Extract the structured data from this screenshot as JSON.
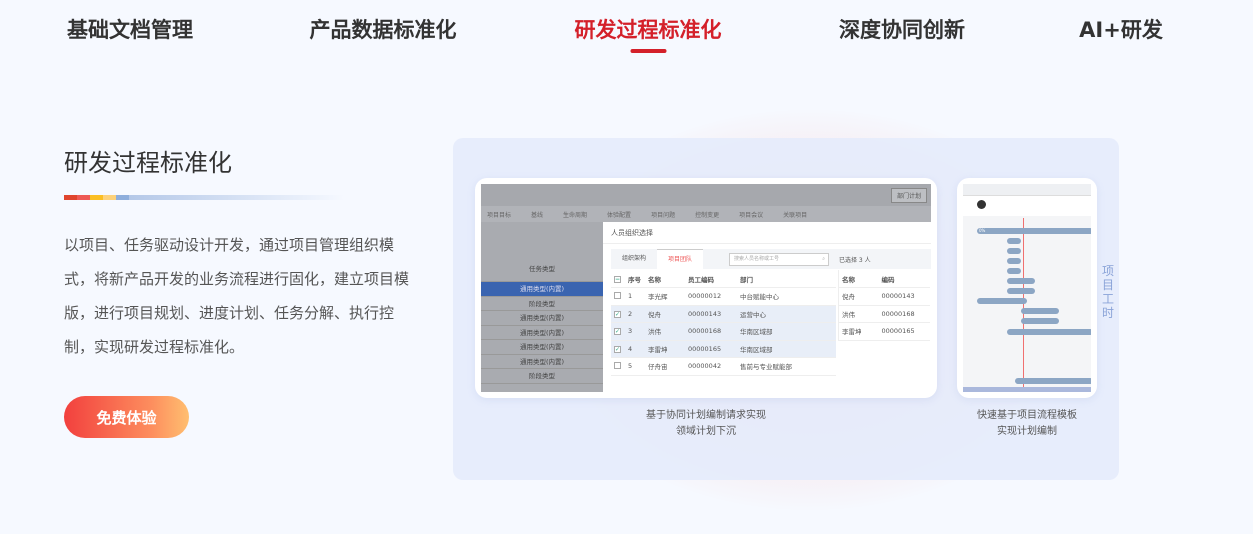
{
  "tabs": [
    {
      "label": "基础文档管理",
      "active": false
    },
    {
      "label": "产品数据标准化",
      "active": false
    },
    {
      "label": "研发过程标准化",
      "active": true
    },
    {
      "label": "深度协同创新",
      "active": false
    },
    {
      "label": "AI+研发",
      "active": false
    }
  ],
  "accent_color": "#d4202a",
  "section": {
    "title": "研发过程标准化",
    "description": "以项目、任务驱动设计开发，通过项目管理组织模式，将新产品开发的业务流程进行固化，建立项目模版，进行项目规划、进度计划、任务分解、执行控制，实现研发过程标准化。",
    "cta_label": "免费体验"
  },
  "card1": {
    "plan_button": "部门计划",
    "nav": [
      "项目目标",
      "基线",
      "生命周期",
      "体验配置",
      "项目问题",
      "控制变更",
      "项目会议",
      "关联项目"
    ],
    "left_rows": [
      "任务类型",
      "通用类型(内置)",
      "阶段类型",
      "通用类型(内置)",
      "通用类型(内置)",
      "通用类型(内置)",
      "通用类型(内置)",
      "阶段类型"
    ],
    "modal_title": "人员组织选择",
    "modal_tabs": [
      "组织架构",
      "项目团队"
    ],
    "search_placeholder": "搜索人员名称或工号",
    "selected_count": "已选择 3 人",
    "columns": [
      "序号",
      "名称",
      "员工编码",
      "部门"
    ],
    "rows": [
      {
        "no": "1",
        "name": "李光辉",
        "code": "00000012",
        "dept": "中台赋能中心",
        "checked": false
      },
      {
        "no": "2",
        "name": "倪舟",
        "code": "00000143",
        "dept": "运营中心",
        "checked": true
      },
      {
        "no": "3",
        "name": "洪伟",
        "code": "00000168",
        "dept": "华南区域部",
        "checked": true
      },
      {
        "no": "4",
        "name": "李雷坤",
        "code": "00000165",
        "dept": "华南区域部",
        "checked": true
      },
      {
        "no": "5",
        "name": "仔舟宙",
        "code": "00000042",
        "dept": "售前与专业赋能部",
        "checked": false
      }
    ],
    "selected_columns": [
      "名称",
      "编码"
    ],
    "selected": [
      {
        "name": "倪舟",
        "code": "00000143"
      },
      {
        "name": "洪伟",
        "code": "00000168"
      },
      {
        "name": "李雷坤",
        "code": "00000165"
      }
    ],
    "caption": [
      "基于协同计划编制请求实现",
      "领域计划下沉"
    ]
  },
  "card2": {
    "caption": [
      "快速基于项目流程模板",
      "实现计划编制"
    ],
    "progress_label": "0%"
  },
  "side_label": "项目工时"
}
